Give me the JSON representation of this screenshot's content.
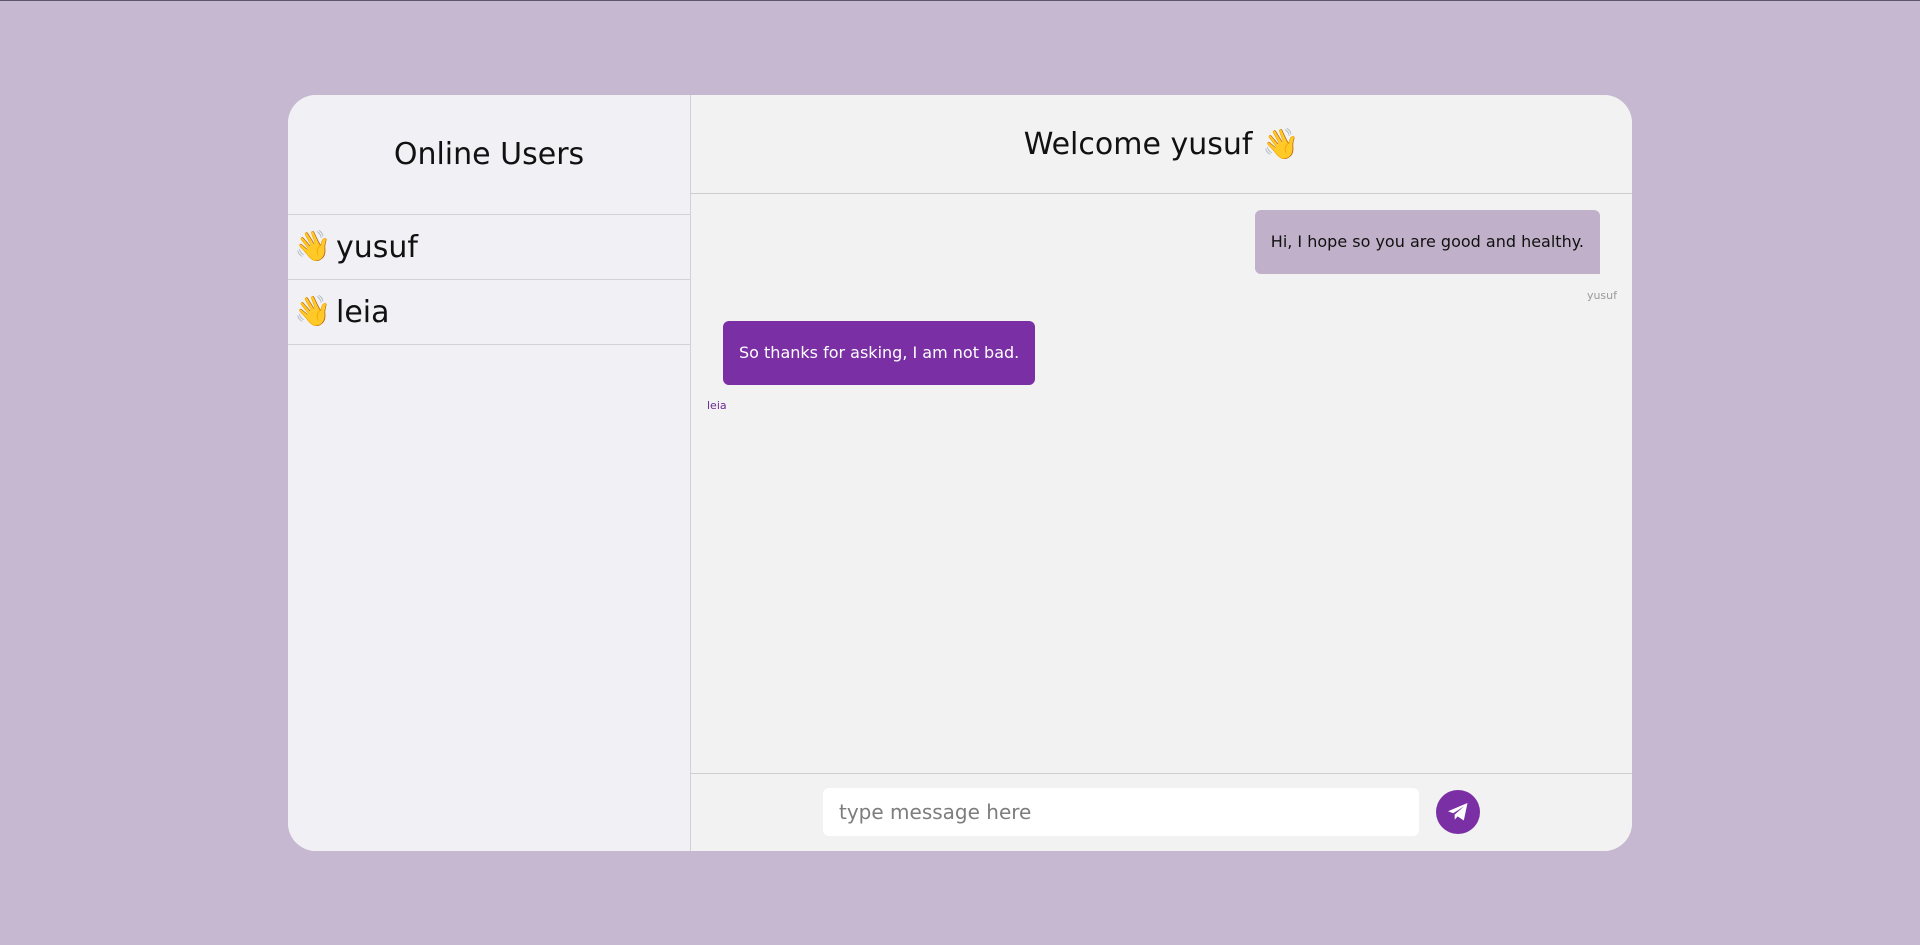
{
  "sidebar": {
    "title": "Online Users",
    "users": [
      {
        "icon": "👋",
        "name": "yusuf"
      },
      {
        "icon": "👋",
        "name": "leia"
      }
    ]
  },
  "chat": {
    "title": "Welcome yusuf 👋",
    "messages": [
      {
        "text": "Hi, I hope so you are good and healthy.",
        "sender": "yusuf",
        "direction": "sent"
      },
      {
        "text": "So thanks for asking, I am not bad.",
        "sender": "leia",
        "direction": "received"
      }
    ]
  },
  "composer": {
    "placeholder": "type message here",
    "send_icon": "paper-plane-icon"
  },
  "colors": {
    "background": "#c5b8d0",
    "accent": "#7a2fa4",
    "sent_bubble": "#c0b0c9"
  }
}
